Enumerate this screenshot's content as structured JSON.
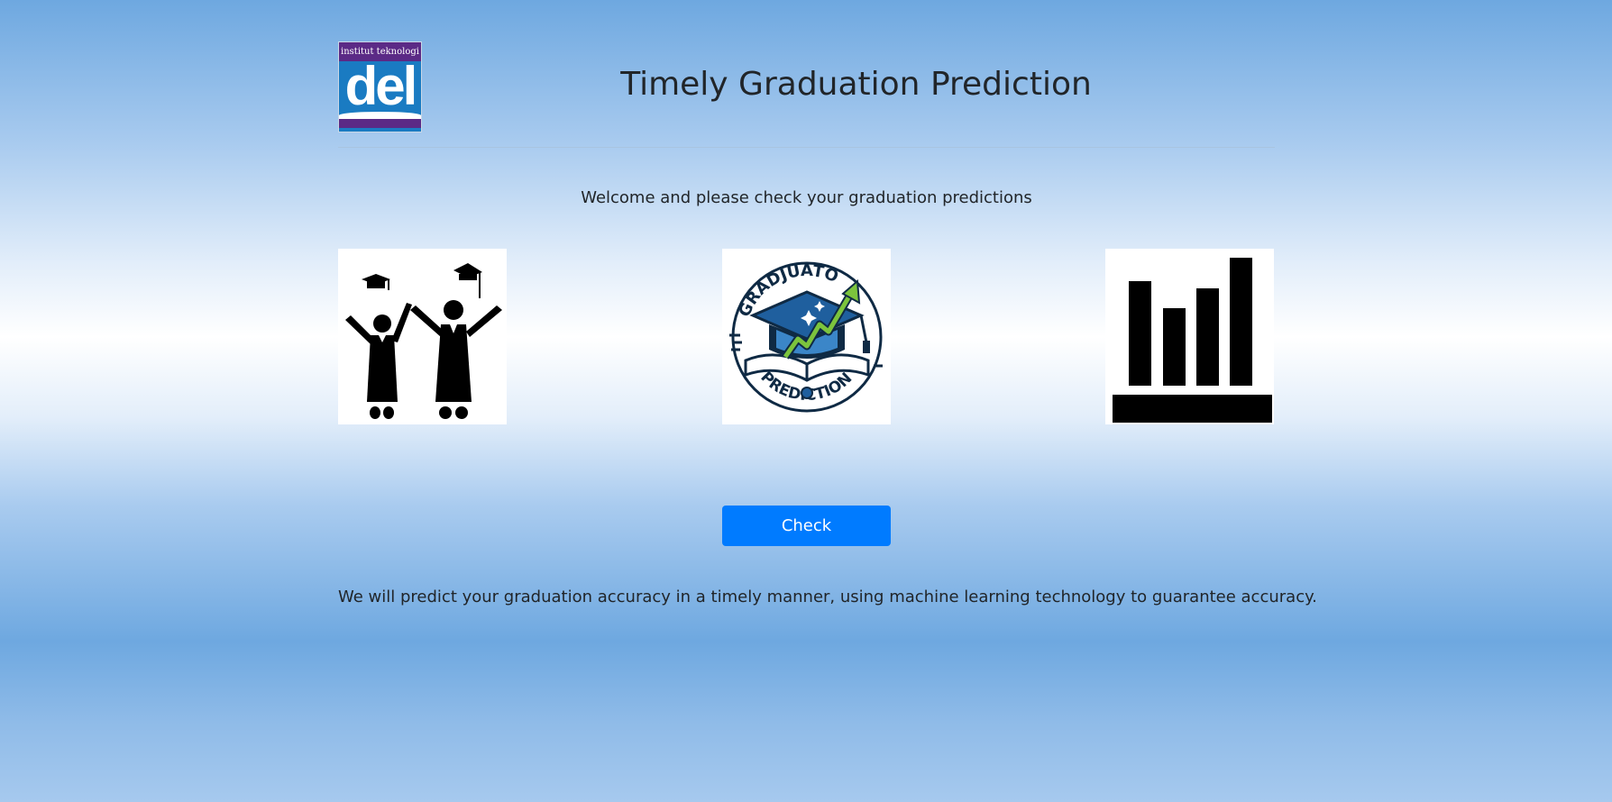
{
  "header": {
    "logo": {
      "top_text": "institut teknologi",
      "word": "del",
      "icon": "institut-teknologi-del-logo"
    },
    "title": "Timely Graduation Prediction"
  },
  "main": {
    "welcome_text": "Welcome and please check your graduation predictions",
    "images": [
      {
        "icon": "graduates-celebrating-icon"
      },
      {
        "icon": "graduation-prediction-badge",
        "arc_text_top": "GRADJUATO",
        "arc_text_bottom": "PREDICTION"
      },
      {
        "icon": "bar-chart-icon"
      }
    ],
    "check_button": "Check",
    "footer_text": "We will predict your graduation accuracy in a timely manner, using machine learning technology to guarantee accuracy."
  },
  "colors": {
    "primary_button": "#007bff",
    "gradient_dark": "#6ea8e0",
    "gradient_light": "#ffffff",
    "text": "#212529"
  }
}
